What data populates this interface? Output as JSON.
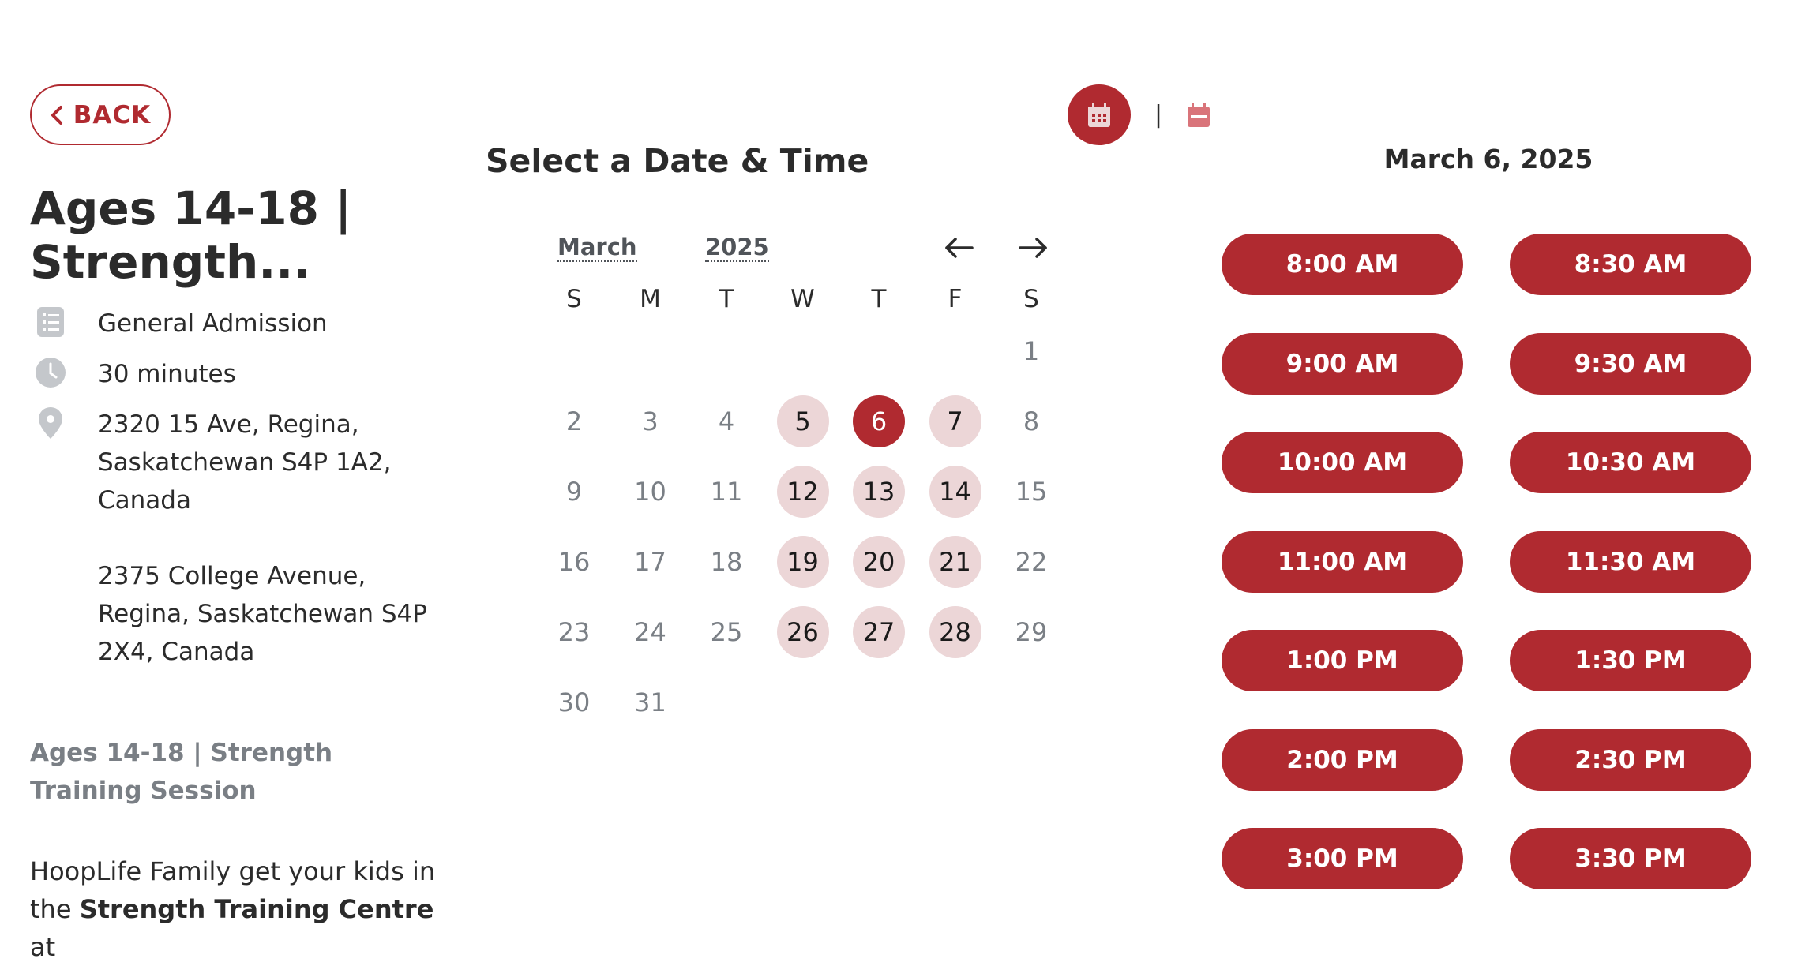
{
  "back": {
    "label": "BACK"
  },
  "event": {
    "title": "Ages 14-18 | Strength...",
    "admission": "General Admission",
    "duration": "30 minutes",
    "location_1": "2320 15 Ave, Regina, Saskatchewan S4P 1A2, Canada",
    "location_2": "2375 College Avenue, Regina, Saskatchewan S4P 2X4, Canada",
    "description_heading": "Ages 14-18 | Strength Training Session",
    "description_pre": "HoopLife Family get your kids in the ",
    "description_bold": "Strength Training Centre",
    "description_post": " at"
  },
  "calendar": {
    "heading": "Select a Date & Time",
    "month": "March",
    "year": "2025",
    "weekdays": [
      "S",
      "M",
      "T",
      "W",
      "T",
      "F",
      "S"
    ],
    "first_weekday_index": 6,
    "days_in_month": 31,
    "available_days": [
      5,
      7,
      12,
      13,
      14,
      19,
      20,
      21,
      26,
      27,
      28
    ],
    "selected_day": 6
  },
  "slots": {
    "date_heading": "March 6, 2025",
    "times": [
      "8:00 AM",
      "8:30 AM",
      "9:00 AM",
      "9:30 AM",
      "10:00 AM",
      "10:30 AM",
      "11:00 AM",
      "11:30 AM",
      "1:00 PM",
      "1:30 PM",
      "2:00 PM",
      "2:30 PM",
      "3:00 PM",
      "3:30 PM"
    ]
  },
  "colors": {
    "accent": "#b02a30",
    "available_bg": "#ecd6d7",
    "muted": "#7a7f85"
  },
  "icons": {
    "back": "chevron-left-icon",
    "admission": "checklist-icon",
    "duration": "clock-icon",
    "location": "map-pin-icon",
    "month_view": "calendar-icon",
    "list_view": "calendar-list-icon"
  }
}
